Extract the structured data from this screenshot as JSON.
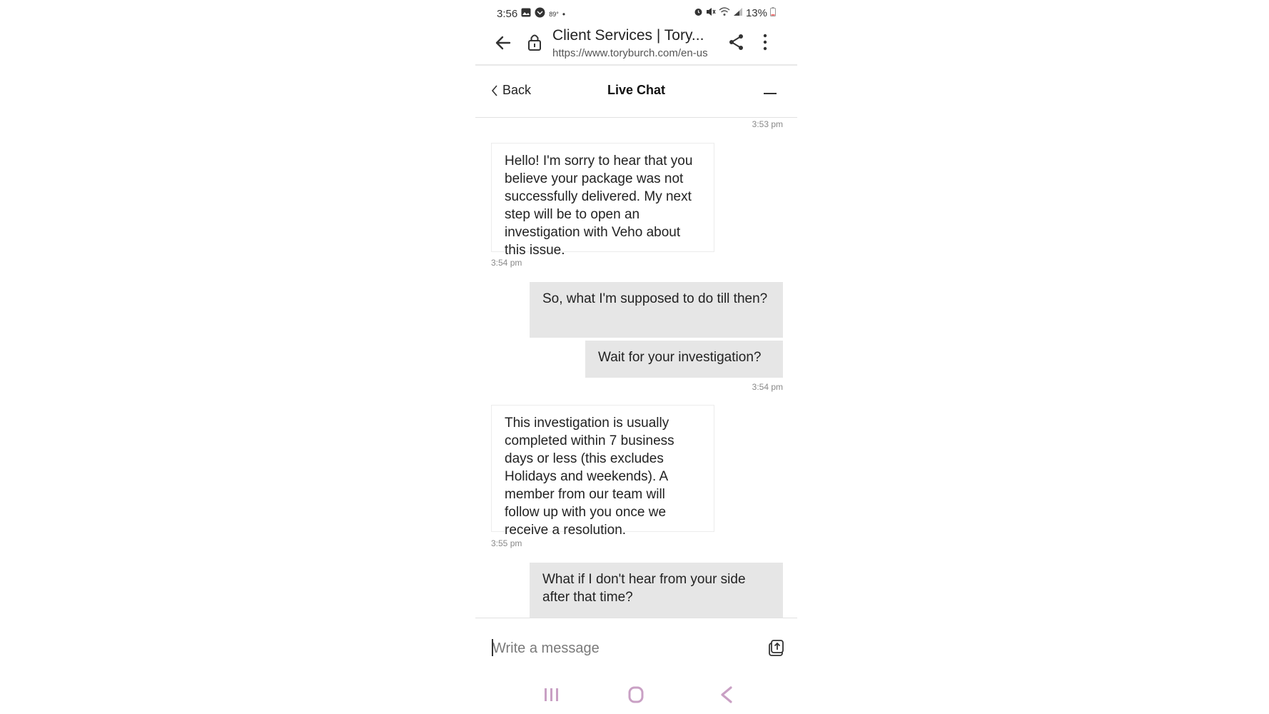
{
  "status_bar": {
    "time": "3:56",
    "temperature": "89°",
    "battery": "13%",
    "icons": [
      "gallery-icon",
      "weather-icon",
      "dot-icon",
      "alarm-icon",
      "mute-icon",
      "wifi-icon",
      "signal-icon",
      "battery-icon"
    ]
  },
  "browser": {
    "page_title": "Client Services | Tory...",
    "url": "https://www.toryburch.com/en-us",
    "icons": [
      "back-arrow-icon",
      "lock-icon",
      "share-icon",
      "more-vert-icon"
    ]
  },
  "chat_header": {
    "back_label": "Back",
    "title": "Live Chat",
    "icons": [
      "chevron-left-icon",
      "minimize-icon"
    ]
  },
  "messages": [
    {
      "type": "timestamp",
      "align": "right",
      "text": "3:53 pm"
    },
    {
      "type": "agent",
      "text": "Hello! I'm sorry to hear that you believe your package was not successfully delivered. My next step will be to open an investigation with Veho about this issue."
    },
    {
      "type": "timestamp",
      "align": "left",
      "text": "3:54 pm"
    },
    {
      "type": "user",
      "text": "So, what I'm supposed to do till then?"
    },
    {
      "type": "user",
      "text": "Wait for your investigation?"
    },
    {
      "type": "timestamp",
      "align": "right",
      "text": "3:54 pm"
    },
    {
      "type": "agent",
      "text": "This investigation is usually completed within 7 business days or less (this excludes Holidays and weekends). A member from our team will follow up with you once we receive a resolution."
    },
    {
      "type": "timestamp",
      "align": "left",
      "text": "3:55 pm"
    },
    {
      "type": "user",
      "text": "What if I don't hear from your side after that time?"
    }
  ],
  "composer": {
    "placeholder": "Write a message",
    "value": "",
    "icons": [
      "attach-upload-icon"
    ]
  },
  "nav_bar": {
    "icons": [
      "recents-icon",
      "home-icon",
      "nav-back-icon"
    ],
    "accent_color": "#c9a0c4"
  }
}
